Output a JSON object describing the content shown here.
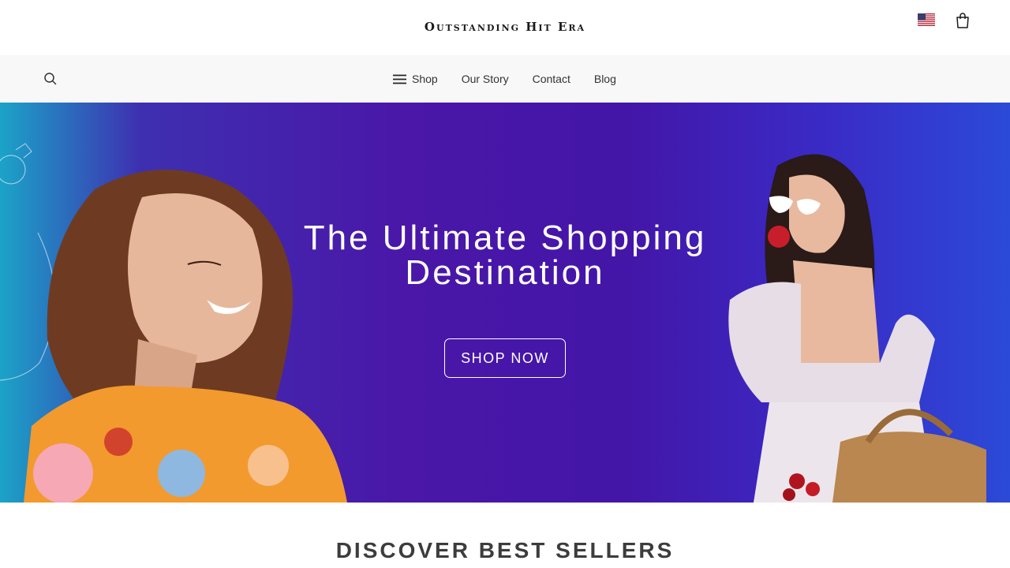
{
  "header": {
    "brand": "Outstanding Hit Era",
    "icons": {
      "locale": "us-flag-icon",
      "cart": "shopping-bag-icon"
    }
  },
  "nav": {
    "search_icon": "search-icon",
    "items": [
      {
        "label": "Shop",
        "icon": "hamburger-menu-icon"
      },
      {
        "label": "Our Story"
      },
      {
        "label": "Contact"
      },
      {
        "label": "Blog"
      }
    ]
  },
  "hero": {
    "title": "The Ultimate Shopping Destination",
    "cta_label": "SHOP NOW",
    "colors": {
      "start": "#1ba3c8",
      "mid": "#4a17a8",
      "end": "#2b4ad8"
    }
  },
  "section": {
    "title": "DISCOVER BEST SELLERS"
  }
}
